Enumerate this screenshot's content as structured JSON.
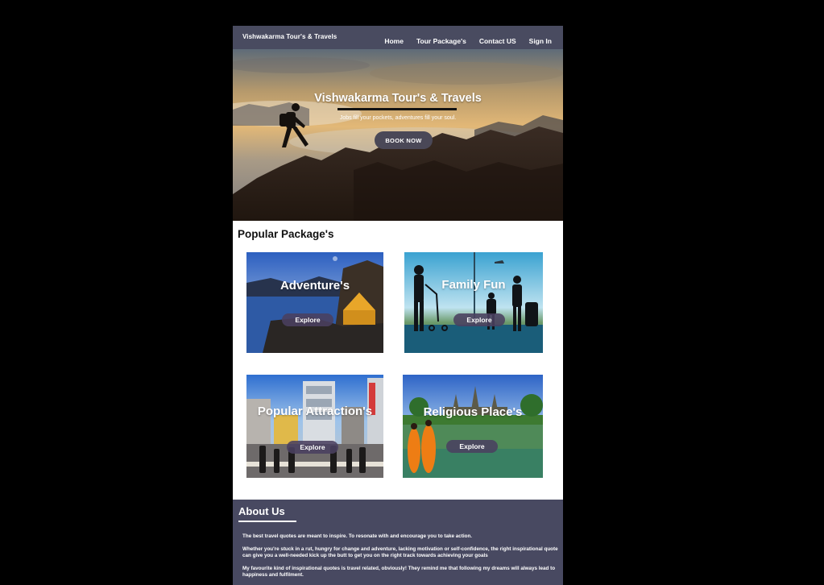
{
  "navbar": {
    "brand": "Vishwakarma Tour's & Travels",
    "links": [
      "Home",
      "Tour Package's",
      "Contact US",
      "Sign In"
    ]
  },
  "hero": {
    "title": "Vishwakarma Tour's & Travels",
    "tagline": "Jobs fill your pockets, adventures fill your soul.",
    "button": "BOOK  NOW"
  },
  "packages": {
    "title": "Popular  Package's",
    "cards": [
      {
        "title": "Adventure's",
        "button": "Explore"
      },
      {
        "title": "Family  Fun",
        "button": "Explore"
      },
      {
        "title": "Popular Attraction's",
        "button": "Explore"
      },
      {
        "title": "Religious Place's",
        "button": "Explore"
      }
    ]
  },
  "about": {
    "title": "About  Us",
    "paragraphs": [
      "The best travel quotes are meant to inspire. To resonate with and encourage you to take action.",
      "Whether you're stuck in a rut, hungry for change and adventure, lacking motivation or self-confidence, the right inspirational quote can give you a well-needed kick up the butt to get you on the right track towards achieving your goals",
      "My favourite kind of inspirational quotes is travel related, obviously! They remind me that following my dreams will always lead to happiness and fulfilment."
    ]
  }
}
